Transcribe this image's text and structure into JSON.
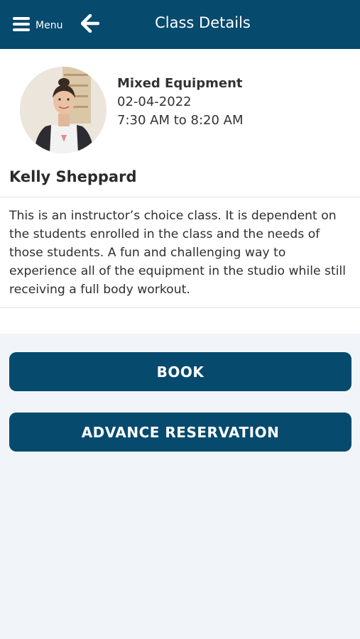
{
  "header": {
    "menu_label": "Menu",
    "title": "Class Details",
    "bar_color": "#064a6e",
    "menu_icon": "hamburger-icon",
    "back_icon": "arrow-left-icon"
  },
  "class_info": {
    "name": "Mixed Equipment",
    "date": "02-04-2022",
    "time": "7:30 AM to 8:20 AM"
  },
  "instructor": {
    "name": "Kelly Sheppard"
  },
  "description": "This is an instructor’s choice class. It is dependent on the students enrolled in the class and the needs of those students. A fun and challenging way to experience all of the equipment in the studio while still receiving a full body workout.",
  "actions": {
    "book_label": "BOOK",
    "reserve_label": "ADVANCE RESERVATION",
    "button_color": "#064a6e"
  }
}
